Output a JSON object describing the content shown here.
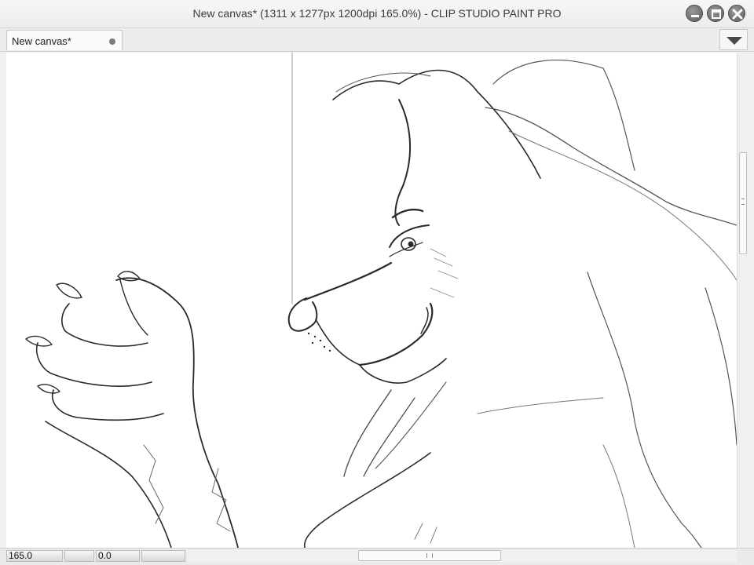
{
  "window": {
    "title": "New canvas* (1311 x 1277px 1200dpi 165.0%)  - CLIP STUDIO PAINT PRO"
  },
  "tabs": [
    {
      "label": "New canvas*",
      "modified_indicator": "dot-icon"
    }
  ],
  "tab_menu_icon": "triangle-down-icon",
  "status": {
    "zoom": "165.0",
    "rotation": "0.0"
  },
  "colors": {
    "canvas_bg": "#ffffff",
    "stroke": "#2a2a2a",
    "window_button": "#6a6a6a"
  }
}
